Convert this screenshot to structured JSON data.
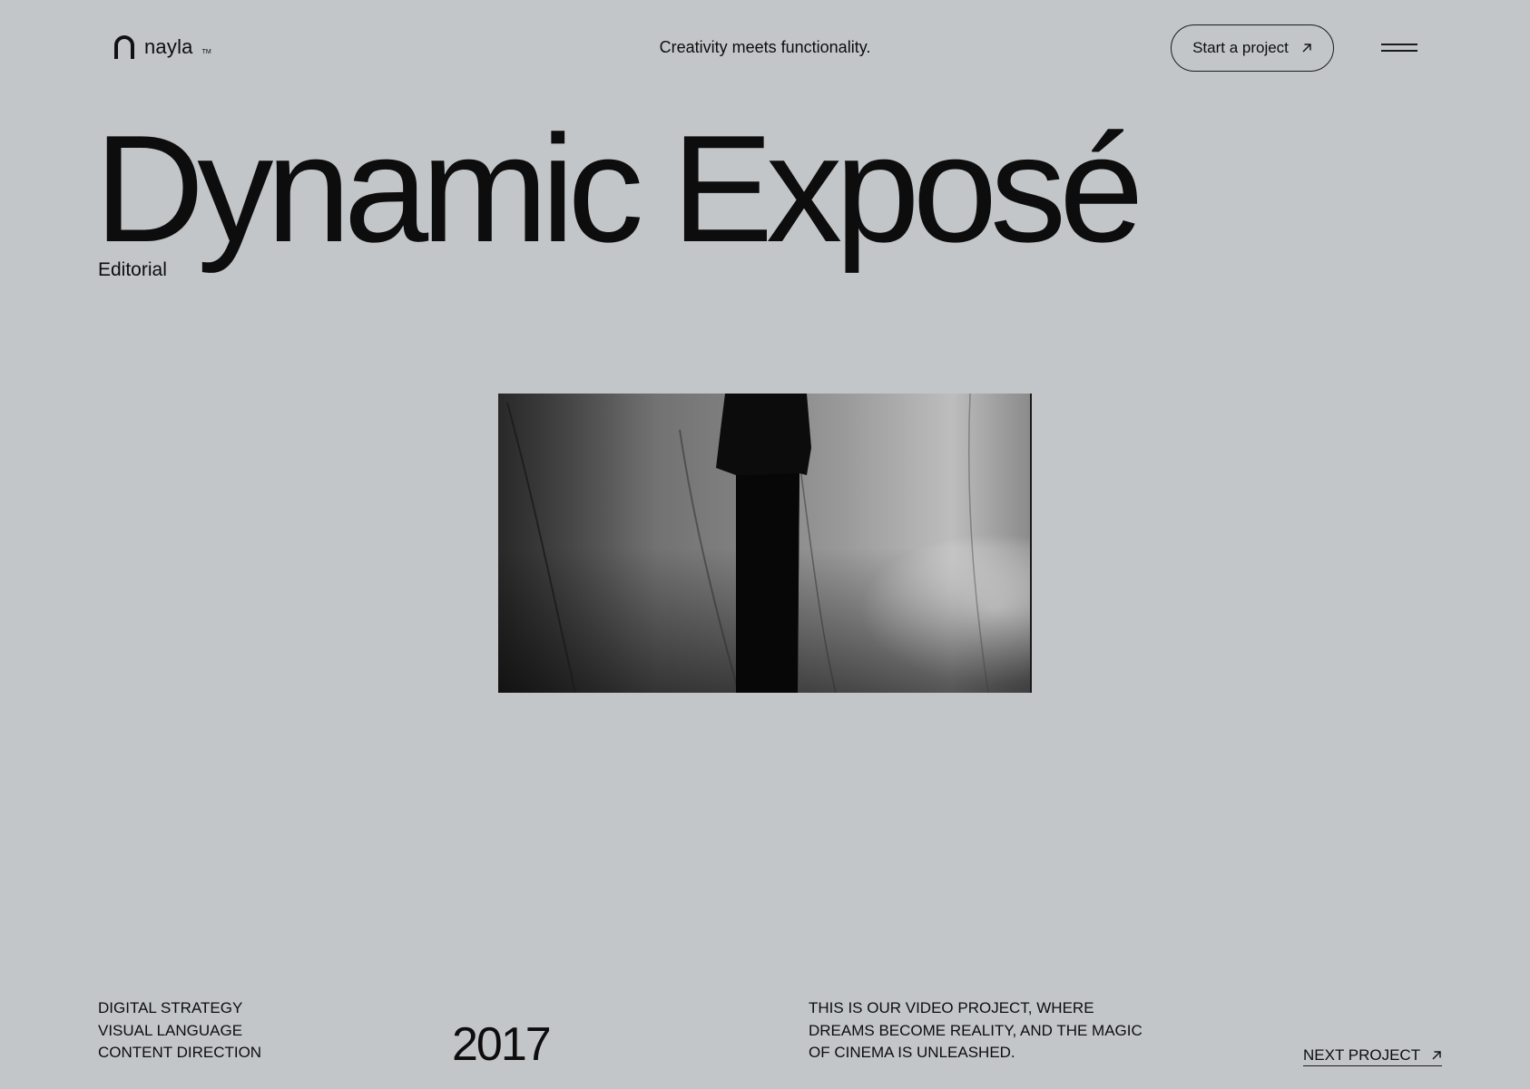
{
  "header": {
    "logo_text": "nayla",
    "logo_tm": "TM",
    "tagline": "Creativity meets functionality.",
    "cta_label": "Start a project"
  },
  "project": {
    "title": "Dynamic Exposé",
    "category": "Editorial",
    "services": [
      "DIGITAL STRATEGY",
      "VISUAL LANGUAGE",
      "CONTENT DIRECTION"
    ],
    "year": "2017",
    "description": [
      "THIS IS OUR VIDEO PROJECT, WHERE",
      "DREAMS BECOME REALITY, AND THE MAGIC",
      "OF CINEMA IS UNLEASHED."
    ]
  },
  "footer": {
    "next_label": "NEXT PROJECT"
  },
  "icons": {
    "logo": "arch-logo-icon",
    "cta": "arrow-up-right-icon",
    "menu": "hamburger-menu-icon",
    "next": "arrow-up-right-icon"
  },
  "colors": {
    "background": "#c3c6c9",
    "text": "#0d0d0d"
  }
}
